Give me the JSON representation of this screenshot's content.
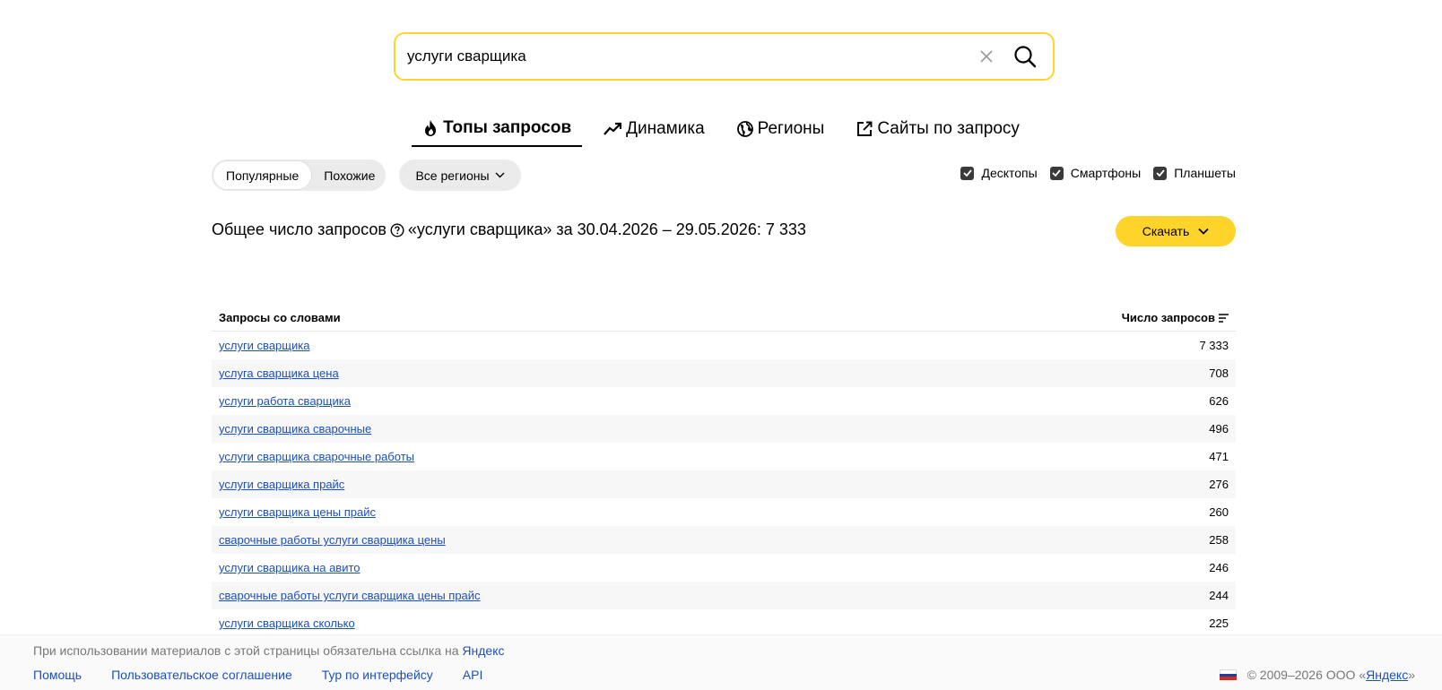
{
  "search": {
    "value": "услуги сварщика"
  },
  "tabs": [
    {
      "label": "Топы запросов",
      "icon": "fire-icon",
      "active": true
    },
    {
      "label": "Динамика",
      "icon": "trend-icon"
    },
    {
      "label": "Регионы",
      "icon": "globe-icon"
    },
    {
      "label": "Сайты по запросу",
      "icon": "external-link-icon"
    }
  ],
  "filters": {
    "mode_popular": "Популярные",
    "mode_similar": "Похожие",
    "region": "Все регионы",
    "devices": {
      "desktop": "Десктопы",
      "smartphone": "Смартфоны",
      "tablet": "Планшеты"
    }
  },
  "summary": {
    "label": "Общее число запросов",
    "detail": "«услуги сварщика» за 30.04.2026 – 29.05.2026: 7 333"
  },
  "download_label": "Скачать",
  "table": {
    "col_query": "Запросы со словами",
    "col_count": "Число запросов",
    "rows": [
      {
        "query": "услуги сварщика",
        "count": "7 333"
      },
      {
        "query": "услуга сварщика цена",
        "count": "708"
      },
      {
        "query": "услуги работа сварщика",
        "count": "626"
      },
      {
        "query": "услуги сварщика сварочные",
        "count": "496"
      },
      {
        "query": "услуги сварщика сварочные работы",
        "count": "471"
      },
      {
        "query": "услуги сварщика прайс",
        "count": "276"
      },
      {
        "query": "услуги сварщика цены прайс",
        "count": "260"
      },
      {
        "query": "сварочные работы услуги сварщика цены",
        "count": "258"
      },
      {
        "query": "услуги сварщика на авито",
        "count": "246"
      },
      {
        "query": "сварочные работы услуги сварщика цены прайс",
        "count": "244"
      },
      {
        "query": "услуги сварщика сколько",
        "count": "225"
      }
    ]
  },
  "footer": {
    "note": "При использовании материалов с этой страницы обязательна ссылка на",
    "note_link": "Яндекс",
    "links": [
      "Помощь",
      "Пользовательское соглашение",
      "Тур по интерфейсу",
      "API"
    ],
    "copyright": "© 2009–2026 ООО «",
    "copyright_link": "Яндекс",
    "copyright_end": "»"
  },
  "colors": {
    "accent": "#fed42b",
    "link": "#1a4fc0"
  }
}
